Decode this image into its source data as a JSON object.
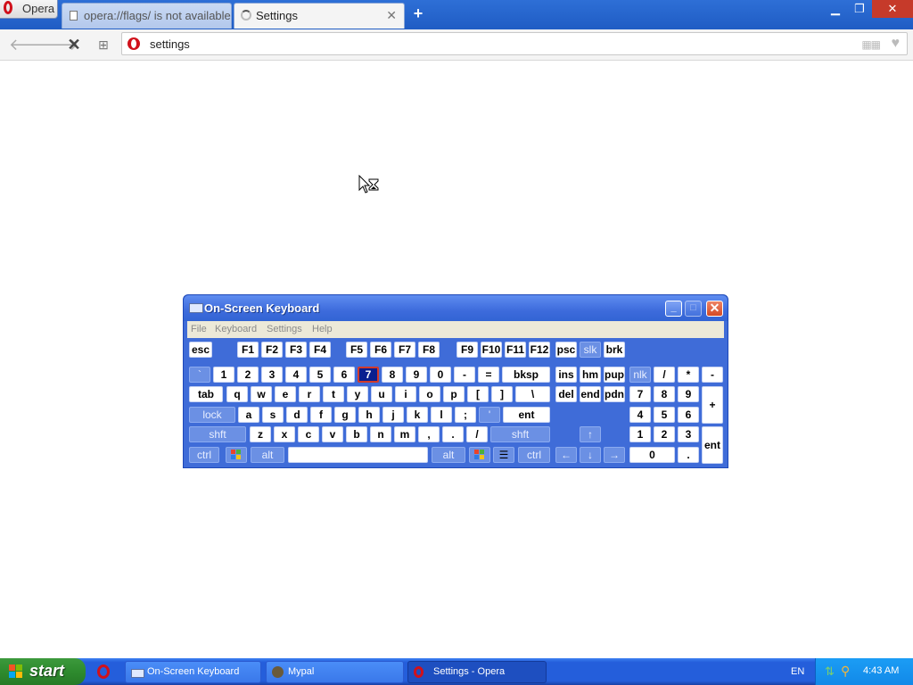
{
  "browser": {
    "menu_label": "Opera",
    "tabs": [
      {
        "label": "opera://flags/ is not available"
      },
      {
        "label": "Settings"
      }
    ],
    "new_tab_symbol": "+",
    "address": "settings"
  },
  "osk": {
    "title": "On-Screen Keyboard",
    "menu": [
      "File",
      "Keyboard",
      "Settings",
      "Help"
    ],
    "rows": {
      "fn": [
        "esc",
        "F1",
        "F2",
        "F3",
        "F4",
        "F5",
        "F6",
        "F7",
        "F8",
        "F9",
        "F10",
        "F11",
        "F12",
        "psc",
        "slk",
        "brk"
      ],
      "num": [
        "`",
        "1",
        "2",
        "3",
        "4",
        "5",
        "6",
        "7",
        "8",
        "9",
        "0",
        "-",
        "=",
        "bksp",
        "ins",
        "hm",
        "pup",
        "nlk",
        "/",
        "*",
        "-"
      ],
      "top": [
        "tab",
        "q",
        "w",
        "e",
        "r",
        "t",
        "y",
        "u",
        "i",
        "o",
        "p",
        "[",
        "]",
        "\\",
        "del",
        "end",
        "pdn",
        "7",
        "8",
        "9",
        "+"
      ],
      "home": [
        "lock",
        "a",
        "s",
        "d",
        "f",
        "g",
        "h",
        "j",
        "k",
        "l",
        ";",
        "'",
        "ent",
        "4",
        "5",
        "6"
      ],
      "bottom": [
        "shft",
        "z",
        "x",
        "c",
        "v",
        "b",
        "n",
        "m",
        ",",
        ".",
        "/",
        "shft",
        "↑",
        "1",
        "2",
        "3",
        "ent"
      ],
      "space": [
        "ctrl",
        "alt",
        "alt",
        "ctrl",
        "←",
        "↓",
        "→",
        "0",
        "."
      ]
    },
    "selected_key": "7"
  },
  "taskbar": {
    "start_label": "start",
    "tasks": [
      "On-Screen Keyboard",
      "Mypal",
      "Settings - Opera"
    ],
    "language": "EN",
    "time": "4:43 AM"
  }
}
